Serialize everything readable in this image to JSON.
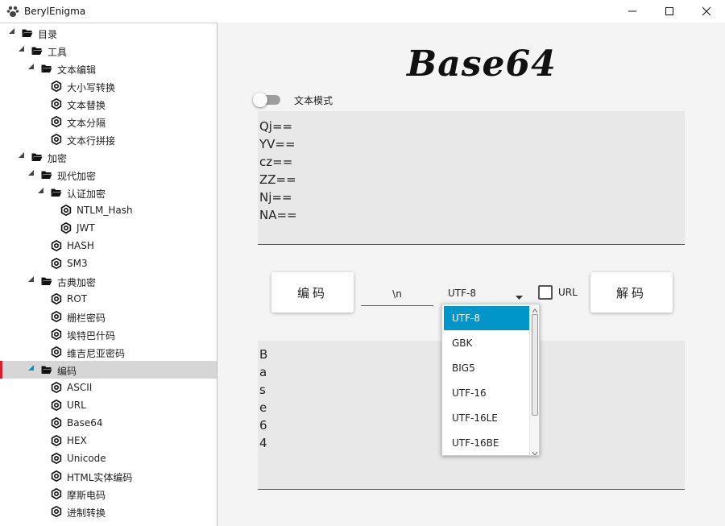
{
  "window": {
    "title": "BerylEnigma"
  },
  "sidebar": {
    "items": [
      {
        "label": "目录",
        "level": 0,
        "type": "folder"
      },
      {
        "label": "工具",
        "level": 1,
        "type": "folder"
      },
      {
        "label": "文本编辑",
        "level": 2,
        "type": "folder"
      },
      {
        "label": "大小写转换",
        "level": 3,
        "type": "leaf"
      },
      {
        "label": "文本替换",
        "level": 3,
        "type": "leaf"
      },
      {
        "label": "文本分隔",
        "level": 3,
        "type": "leaf"
      },
      {
        "label": "文本行拼接",
        "level": 3,
        "type": "leaf"
      },
      {
        "label": "加密",
        "level": 1,
        "type": "folder"
      },
      {
        "label": "现代加密",
        "level": 2,
        "type": "folder"
      },
      {
        "label": "认证加密",
        "level": 3,
        "type": "folder"
      },
      {
        "label": "NTLM_Hash",
        "level": 4,
        "type": "leaf"
      },
      {
        "label": "JWT",
        "level": 4,
        "type": "leaf"
      },
      {
        "label": "HASH",
        "level": 3,
        "type": "leaf"
      },
      {
        "label": "SM3",
        "level": 3,
        "type": "leaf"
      },
      {
        "label": "古典加密",
        "level": 2,
        "type": "folder"
      },
      {
        "label": "ROT",
        "level": 3,
        "type": "leaf"
      },
      {
        "label": "栅栏密码",
        "level": 3,
        "type": "leaf"
      },
      {
        "label": "埃特巴什码",
        "level": 3,
        "type": "leaf"
      },
      {
        "label": "维吉尼亚密码",
        "level": 3,
        "type": "leaf"
      },
      {
        "label": "编码",
        "level": 2,
        "type": "folder",
        "selected": true
      },
      {
        "label": "ASCII",
        "level": 3,
        "type": "leaf"
      },
      {
        "label": "URL",
        "level": 3,
        "type": "leaf"
      },
      {
        "label": "Base64",
        "level": 3,
        "type": "leaf"
      },
      {
        "label": "HEX",
        "level": 3,
        "type": "leaf"
      },
      {
        "label": "Unicode",
        "level": 3,
        "type": "leaf"
      },
      {
        "label": "HTML实体编码",
        "level": 3,
        "type": "leaf"
      },
      {
        "label": "摩斯电码",
        "level": 3,
        "type": "leaf"
      },
      {
        "label": "进制转换",
        "level": 3,
        "type": "leaf"
      }
    ]
  },
  "main": {
    "logo": "Base64",
    "text_mode": {
      "label": "文本模式",
      "on": false
    },
    "input_text": "Qj==\nYV==\ncz==\nZZ==\nNj==\nNA==",
    "encode_button": "编码",
    "separator": "\\n",
    "charset": {
      "selected": "UTF-8",
      "options": [
        "UTF-8",
        "GBK",
        "BIG5",
        "UTF-16",
        "UTF-16LE",
        "UTF-16BE"
      ]
    },
    "url_checkbox": {
      "label": "URL",
      "checked": false
    },
    "decode_button": "解码",
    "output_text": "B\na\ns\ne\n6\n4"
  },
  "colors": {
    "accent": "#0096c9",
    "selection_marker": "#e0192d"
  }
}
